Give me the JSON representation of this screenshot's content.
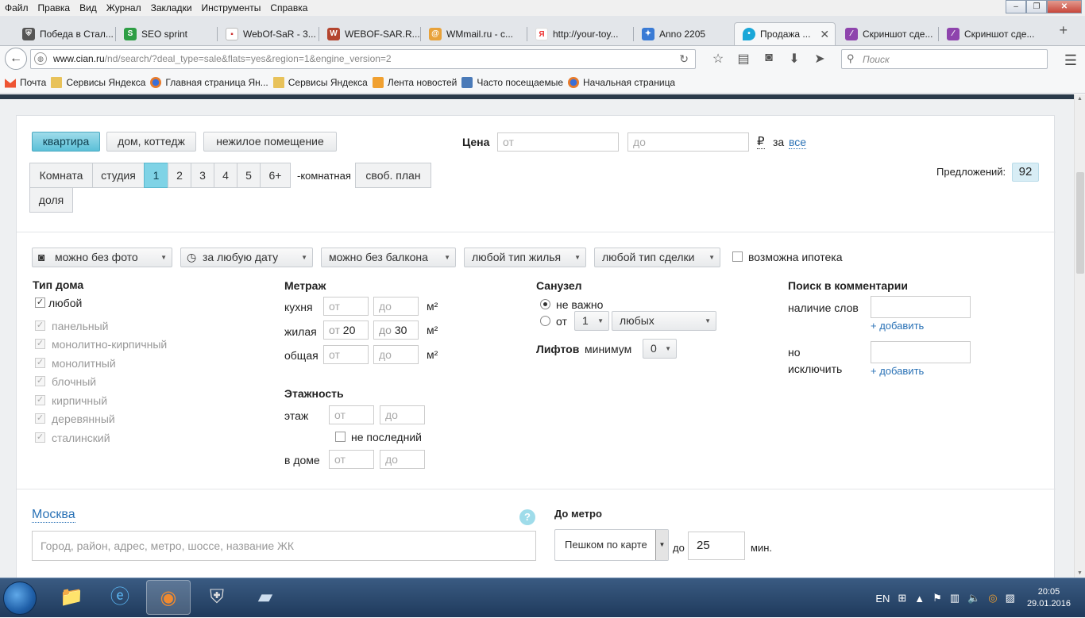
{
  "menu": [
    "Файл",
    "Правка",
    "Вид",
    "Журнал",
    "Закладки",
    "Инструменты",
    "Справка"
  ],
  "tabs": [
    {
      "label": "Победа в Стал...",
      "icon": "tanks-icon",
      "color": "#555"
    },
    {
      "label": "SEO sprint",
      "icon": "seosprint-icon",
      "color": "#2e9e45"
    },
    {
      "label": "WebOf-SaR - 3...",
      "icon": "page-icon",
      "color": "#c33"
    },
    {
      "label": "WEBOF-SAR.R...",
      "icon": "webof-icon",
      "color": "#b4452f"
    },
    {
      "label": "WMmail.ru - с...",
      "icon": "wmmail-icon",
      "color": "#e8a23a"
    },
    {
      "label": "http://your-toy...",
      "icon": "yandex-icon",
      "color": "#e33"
    },
    {
      "label": "Anno 2205",
      "icon": "anno-icon",
      "color": "#3a7bd5"
    },
    {
      "label": "Продажа ...",
      "icon": "location-pin-icon",
      "color": "#1aa7d8"
    },
    {
      "label": "Скриншот сде...",
      "icon": "feather-icon",
      "color": "#8e44ad"
    },
    {
      "label": "Скриншот сде...",
      "icon": "feather-icon",
      "color": "#8e44ad"
    }
  ],
  "url": {
    "host": "www.cian.ru",
    "path": "/nd/search/?deal_type=sale&flats=yes&region=1&engine_version=2"
  },
  "search_placeholder": "Поиск",
  "bookmarks": [
    {
      "label": "Почта",
      "icon": "yandex-mail-icon",
      "color": "#e53"
    },
    {
      "label": "Сервисы Яндекса",
      "icon": "folder-icon",
      "color": "#e8c25a"
    },
    {
      "label": "Главная страница Ян...",
      "icon": "firefox-icon",
      "color": "#e87a2a"
    },
    {
      "label": "Сервисы Яндекса",
      "icon": "folder-icon",
      "color": "#e8c25a"
    },
    {
      "label": "Лента новостей",
      "icon": "rss-icon",
      "color": "#f0a030"
    },
    {
      "label": "Часто посещаемые",
      "icon": "history-icon",
      "color": "#4a7ab8"
    },
    {
      "label": "Начальная страница",
      "icon": "firefox-icon",
      "color": "#e87a2a"
    }
  ],
  "search": {
    "property_types": [
      "квартира",
      "дом, коттедж",
      "нежилое помещение"
    ],
    "selected_property": 0,
    "price": {
      "label": "Цена",
      "from": "от",
      "to": "до",
      "currency": "₽",
      "per": "за",
      "per_link": "все"
    },
    "offers": {
      "label": "Предложений:",
      "count": "92"
    },
    "rooms": [
      "Комната",
      "студия",
      "1",
      "2",
      "3",
      "4",
      "5",
      "6+"
    ],
    "rooms_selected": 2,
    "rooms_suffix": "-комнатная",
    "free_plan": "своб. план",
    "share": "доля",
    "filters": [
      "можно без фото",
      "за любую дату",
      "можно без балкона",
      "любой тип жилья",
      "любой тип сделки"
    ],
    "mortgage": "возможна ипотека",
    "house_type": {
      "title": "Тип дома",
      "any": "любой",
      "items": [
        "панельный",
        "монолитно-кирпичный",
        "монолитный",
        "блочный",
        "кирпичный",
        "деревянный",
        "сталинский"
      ]
    },
    "area": {
      "title": "Метраж",
      "kitchen": "кухня",
      "living": "жилая",
      "total": "общая",
      "unit": "м²",
      "from": "от",
      "to": "до",
      "living_from": "20",
      "living_to": "30"
    },
    "floors": {
      "title": "Этажность",
      "floor": "этаж",
      "not_last": "не последний",
      "in_house": "в доме",
      "from": "от",
      "to": "до"
    },
    "bathroom": {
      "title": "Санузел",
      "not_important": "не важно",
      "from": "от",
      "count": "1",
      "kind": "любых"
    },
    "lifts": {
      "title": "Лифтов",
      "min": "минимум",
      "value": "0"
    },
    "comments": {
      "title": "Поиск в комментарии",
      "has_words": "наличие слов",
      "add": "+ добавить",
      "exclude_1": "но",
      "exclude_2": "исключить"
    },
    "location": {
      "city": "Москва",
      "placeholder": "Город, район, адрес, метро, шоссе, название ЖК",
      "help": "?"
    },
    "metro": {
      "title": "До метро",
      "mode": "Пешком по карте",
      "to": "до",
      "minutes": "25",
      "unit": "мин."
    }
  },
  "taskbar": {
    "lang": "EN",
    "time": "20:05",
    "date": "29.01.2016"
  }
}
